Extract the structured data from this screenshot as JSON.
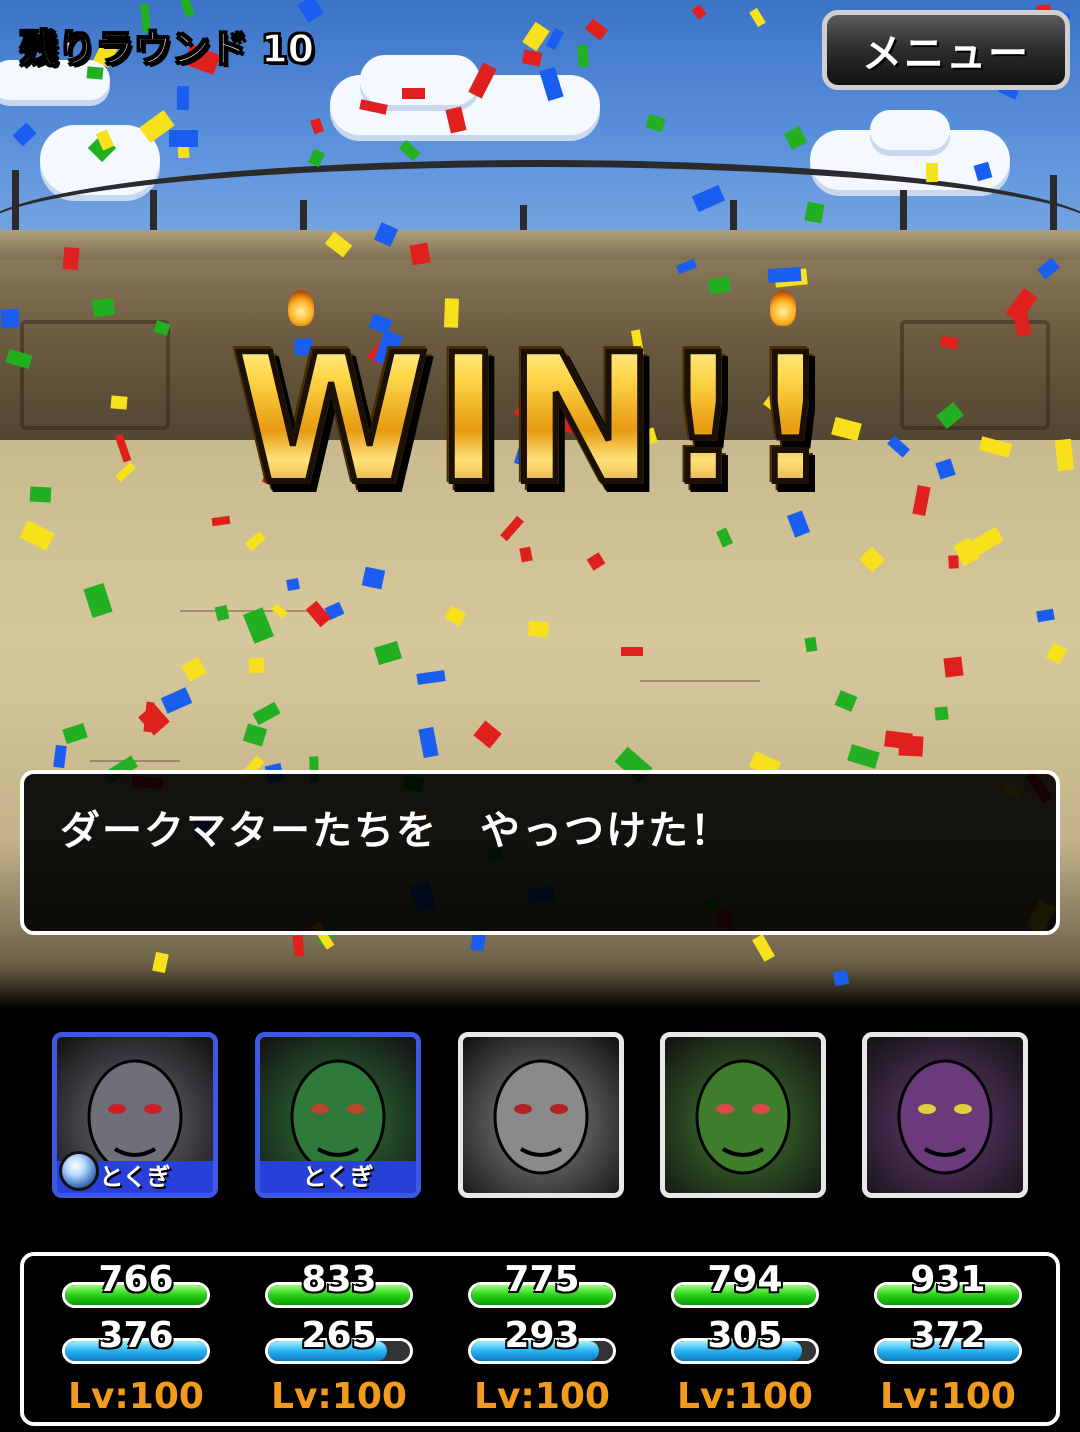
{
  "hud": {
    "rounds_left": "残りラウンド 10",
    "menu_label": "メニュー"
  },
  "banner": {
    "text": "WIN!!"
  },
  "message": {
    "text": "ダークマターたちを　やっつけた！"
  },
  "party": [
    {
      "skill_label": "とくぎ",
      "has_skill": true,
      "has_gem": true,
      "frame": "blue",
      "face_color": "#6f6f7a",
      "accent": "#c8202a",
      "hp": "766",
      "mp": "376",
      "hp_ratio": 1.0,
      "mp_ratio": 1.0,
      "level": "Lv:100"
    },
    {
      "skill_label": "とくぎ",
      "has_skill": true,
      "has_gem": false,
      "frame": "blue",
      "face_color": "#2f7a3a",
      "accent": "#b9462a",
      "hp": "833",
      "mp": "265",
      "hp_ratio": 1.0,
      "mp_ratio": 0.84,
      "level": "Lv:100"
    },
    {
      "skill_label": "",
      "has_skill": false,
      "has_gem": false,
      "frame": "white",
      "face_color": "#8a8a8a",
      "accent": "#b22222",
      "hp": "775",
      "mp": "293",
      "hp_ratio": 1.0,
      "mp_ratio": 0.9,
      "level": "Lv:100"
    },
    {
      "skill_label": "",
      "has_skill": false,
      "has_gem": false,
      "frame": "white",
      "face_color": "#3f7d2c",
      "accent": "#d94a4a",
      "hp": "794",
      "mp": "305",
      "hp_ratio": 1.0,
      "mp_ratio": 0.9,
      "level": "Lv:100"
    },
    {
      "skill_label": "",
      "has_skill": false,
      "has_gem": false,
      "frame": "white",
      "face_color": "#6a3a7a",
      "accent": "#e0d040",
      "hp": "931",
      "mp": "372",
      "hp_ratio": 1.0,
      "mp_ratio": 1.0,
      "level": "Lv:100"
    }
  ],
  "colors": {
    "frame_blue": "#3c59e6",
    "level_text": "#f29a1c",
    "hp_bar": "#29d21a",
    "mp_bar": "#25b4f2"
  }
}
